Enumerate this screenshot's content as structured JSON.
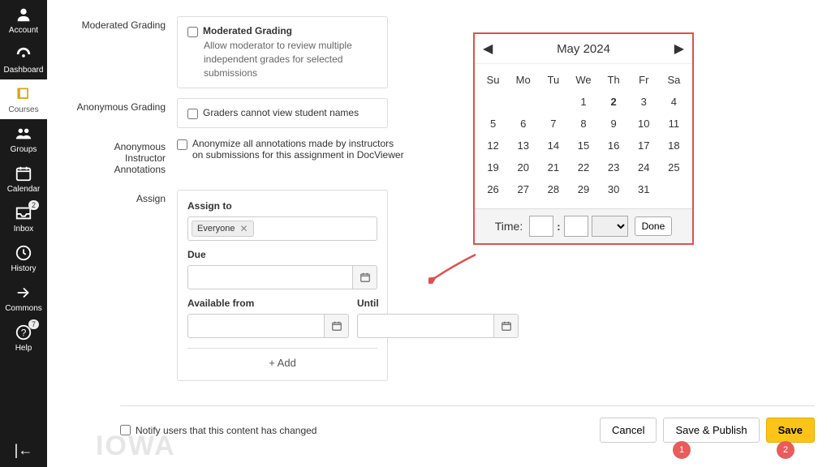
{
  "sidebar": {
    "items": [
      {
        "label": "Account",
        "icon": "account"
      },
      {
        "label": "Dashboard",
        "icon": "dashboard"
      },
      {
        "label": "Courses",
        "icon": "courses",
        "active": true
      },
      {
        "label": "Groups",
        "icon": "groups"
      },
      {
        "label": "Calendar",
        "icon": "calendar"
      },
      {
        "label": "Inbox",
        "icon": "inbox",
        "badge": "2"
      },
      {
        "label": "History",
        "icon": "history"
      },
      {
        "label": "Commons",
        "icon": "commons"
      },
      {
        "label": "Help",
        "icon": "help",
        "badge": "7"
      }
    ]
  },
  "form": {
    "moderated_grading": {
      "label": "Moderated Grading",
      "checkbox": "Moderated Grading",
      "desc": "Allow moderator to review multiple independent grades for selected submissions"
    },
    "anonymous_grading": {
      "label": "Anonymous Grading",
      "checkbox": "Graders cannot view student names"
    },
    "anonymous_annotations": {
      "label": "Anonymous Instructor Annotations",
      "checkbox": "Anonymize all annotations made by instructors on submissions for this assignment in DocViewer"
    },
    "assign": {
      "label": "Assign",
      "assign_to_label": "Assign to",
      "assign_to_tag": "Everyone",
      "due_label": "Due",
      "available_from_label": "Available from",
      "until_label": "Until",
      "add_label": "+  Add"
    }
  },
  "calendar": {
    "month_title": "May 2024",
    "day_heads": [
      "Su",
      "Mo",
      "Tu",
      "We",
      "Th",
      "Fr",
      "Sa"
    ],
    "weeks": [
      [
        "",
        "",
        "",
        "1",
        "2",
        "3",
        "4"
      ],
      [
        "5",
        "6",
        "7",
        "8",
        "9",
        "10",
        "11"
      ],
      [
        "12",
        "13",
        "14",
        "15",
        "16",
        "17",
        "18"
      ],
      [
        "19",
        "20",
        "21",
        "22",
        "23",
        "24",
        "25"
      ],
      [
        "26",
        "27",
        "28",
        "29",
        "30",
        "31",
        ""
      ]
    ],
    "selected_day": "2",
    "time_label": "Time:",
    "done_label": "Done"
  },
  "footer": {
    "notify_label": "Notify users that this content has changed",
    "cancel": "Cancel",
    "save_publish": "Save & Publish",
    "save": "Save"
  },
  "callouts": {
    "one": "1",
    "two": "2"
  },
  "watermark": "IOWA"
}
